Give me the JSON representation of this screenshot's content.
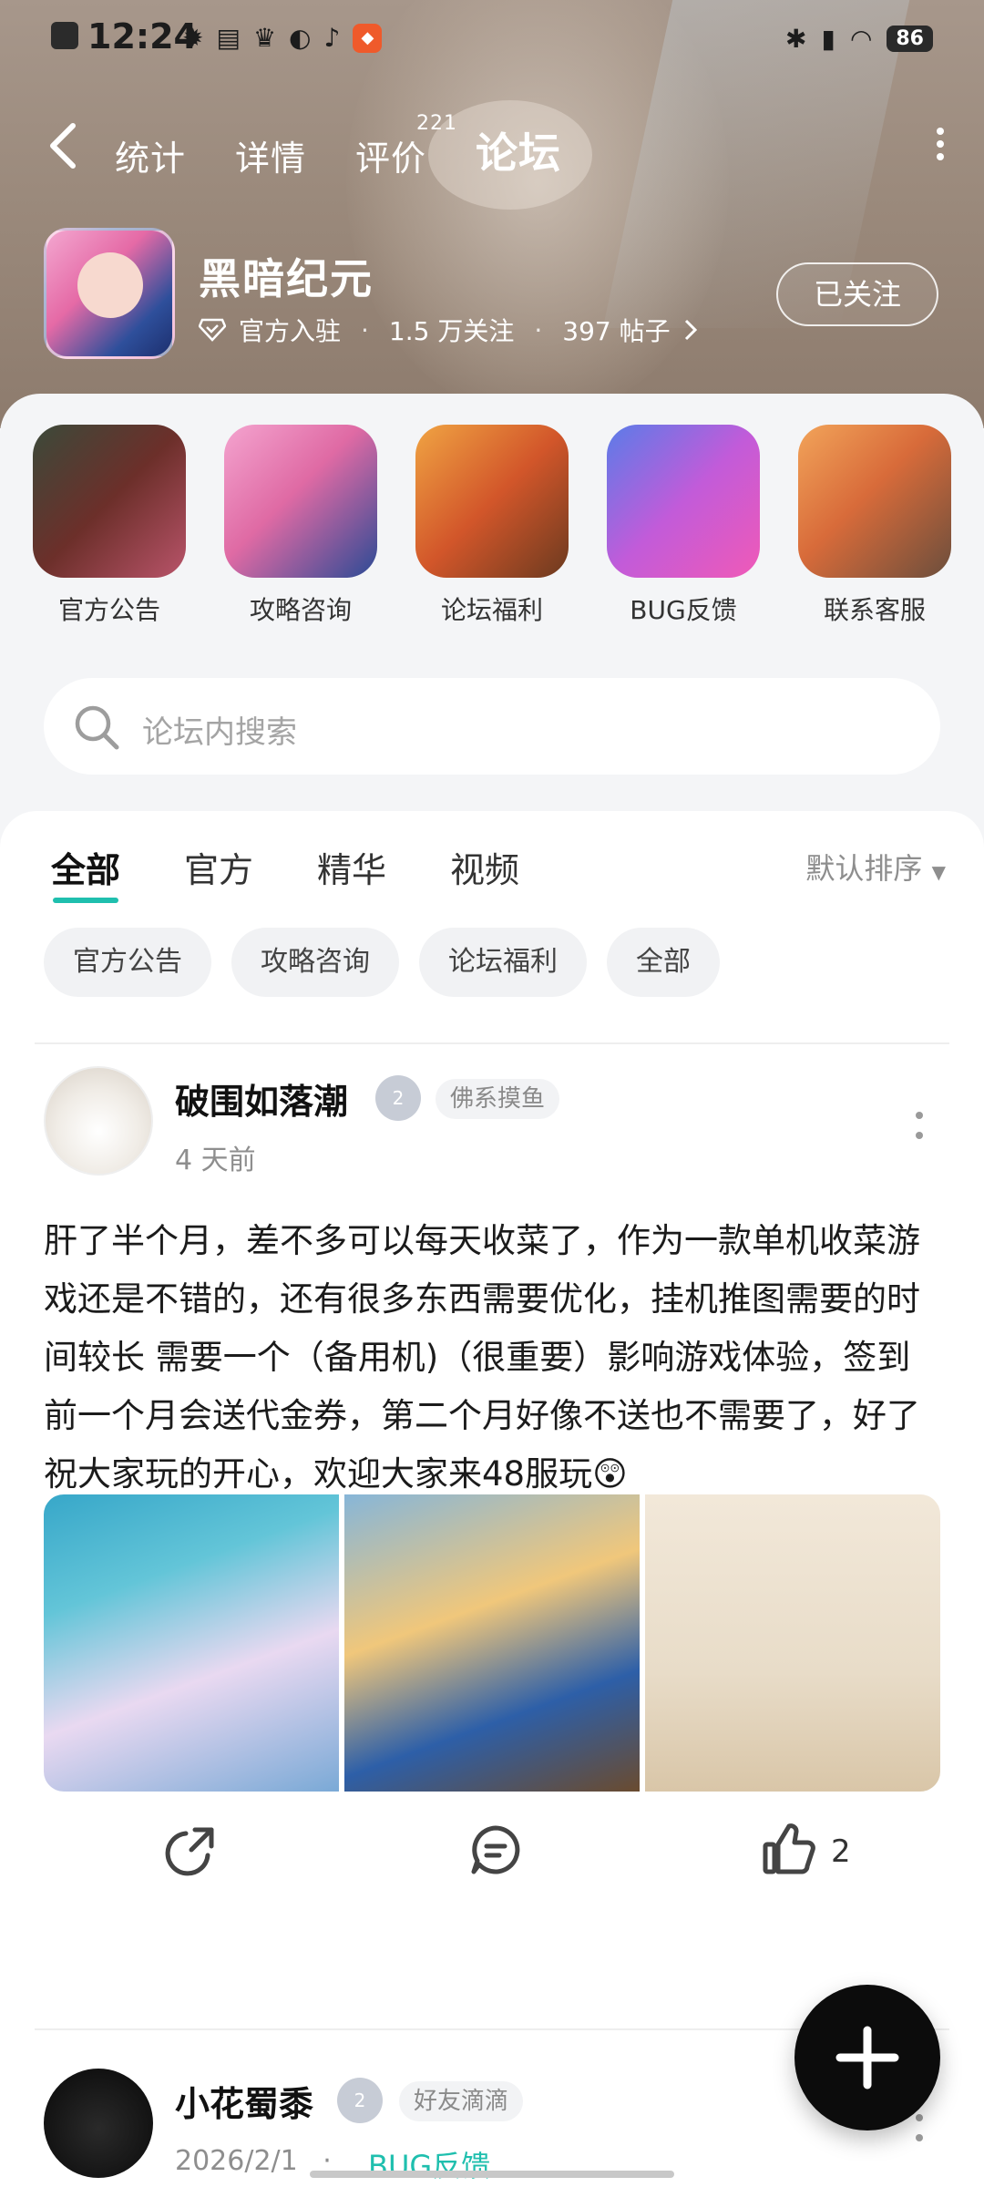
{
  "statusbar": {
    "time": "12:24",
    "battery": "86"
  },
  "nav": {
    "tabs": [
      {
        "label": "统计"
      },
      {
        "label": "详情"
      },
      {
        "label": "评价",
        "badge": "221"
      },
      {
        "label": "论坛"
      }
    ],
    "active_tab": "论坛"
  },
  "game": {
    "title": "黑暗纪元",
    "official": "官方入驻",
    "followers": "1.5 万关注",
    "posts": "397 帖子",
    "follow_button": "已关注"
  },
  "shortcuts": [
    {
      "label": "官方公告"
    },
    {
      "label": "攻略咨询"
    },
    {
      "label": "论坛福利"
    },
    {
      "label": "BUG反馈"
    },
    {
      "label": "联系客服"
    }
  ],
  "search": {
    "placeholder": "论坛内搜索"
  },
  "feed": {
    "tabs": [
      "全部",
      "官方",
      "精华",
      "视频"
    ],
    "active_tab": "全部",
    "sort": "默认排序",
    "chips": [
      "官方公告",
      "攻略咨询",
      "论坛福利",
      "全部"
    ]
  },
  "posts": [
    {
      "user": "破围如落潮",
      "level": "2",
      "tag": "佛系摸鱼",
      "time": "4 天前",
      "content": "肝了半个月，差不多可以每天收菜了，作为一款单机收菜游戏还是不错的，还有很多东西需要优化，挂机推图需要的时间较长 需要一个（备用机)（很重要）影响游戏体验，签到前一个月会送代金券，第二个月好像不送也不需要了，好了祝大家玩的开心，欢迎大家来48服玩😲",
      "likes": "2"
    },
    {
      "user": "小花蜀黍",
      "level": "2",
      "tag": "好友滴滴",
      "time": "2026/2/1",
      "category": "BUG反馈"
    }
  ],
  "colors": {
    "accent": "#1fbfae",
    "tab_highlight": "#2fc8b6"
  }
}
